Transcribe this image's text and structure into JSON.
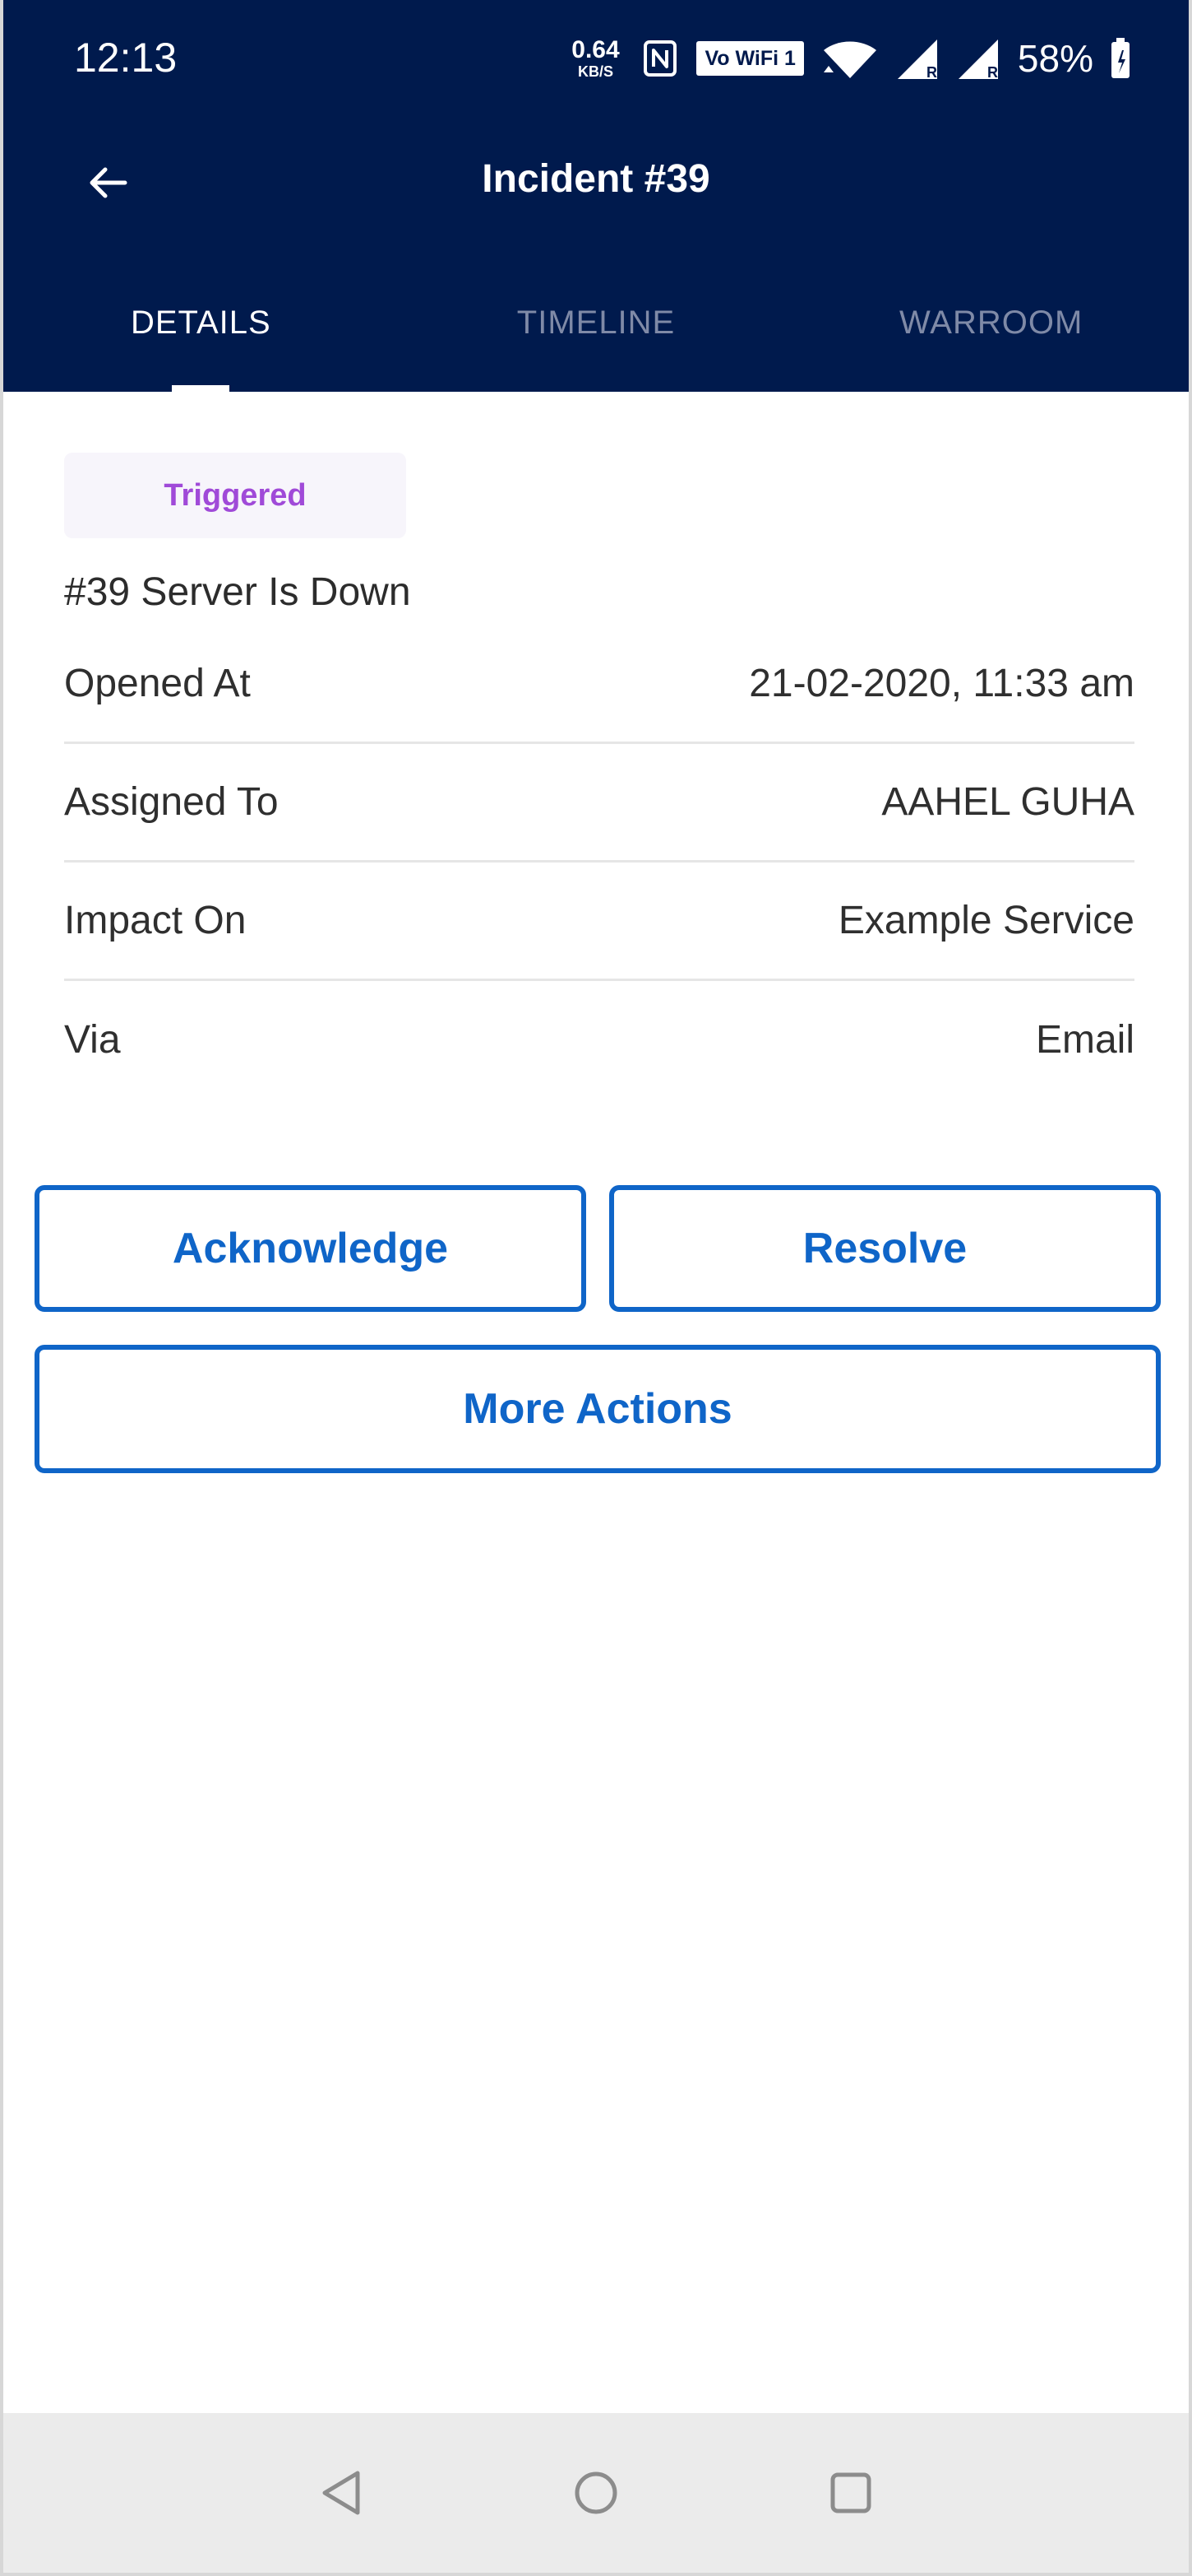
{
  "status_bar": {
    "time": "12:13",
    "network_speed_value": "0.64",
    "network_speed_unit": "KB/S",
    "vowifi_label": "Vo WiFi 1",
    "battery_percent": "58%",
    "icons": [
      "nfc-icon",
      "wifi-icon",
      "signal-icon",
      "signal-icon",
      "battery-icon"
    ]
  },
  "app_bar": {
    "title": "Incident #39",
    "back_icon": "arrow-left-icon"
  },
  "tabs": [
    {
      "label": "DETAILS",
      "active": true
    },
    {
      "label": "TIMELINE",
      "active": false
    },
    {
      "label": "WARROOM",
      "active": false
    }
  ],
  "incident": {
    "status": "Triggered",
    "title": "#39  Server Is Down",
    "fields": [
      {
        "label": "Opened At",
        "value": "21-02-2020, 11:33 am"
      },
      {
        "label": "Assigned To",
        "value": "AAHEL GUHA"
      },
      {
        "label": "Impact On",
        "value": "Example Service"
      },
      {
        "label": "Via",
        "value": "Email"
      }
    ]
  },
  "actions": {
    "acknowledge": "Acknowledge",
    "resolve": "Resolve",
    "more_actions": "More Actions"
  },
  "colors": {
    "header_bg": "#001a4d",
    "primary_blue": "#0f65c8",
    "triggered_purple": "#a04ad8",
    "nav_bg": "#ebebeb"
  },
  "system_nav": {
    "icons": [
      "back-triangle-icon",
      "home-circle-icon",
      "recents-square-icon"
    ]
  }
}
